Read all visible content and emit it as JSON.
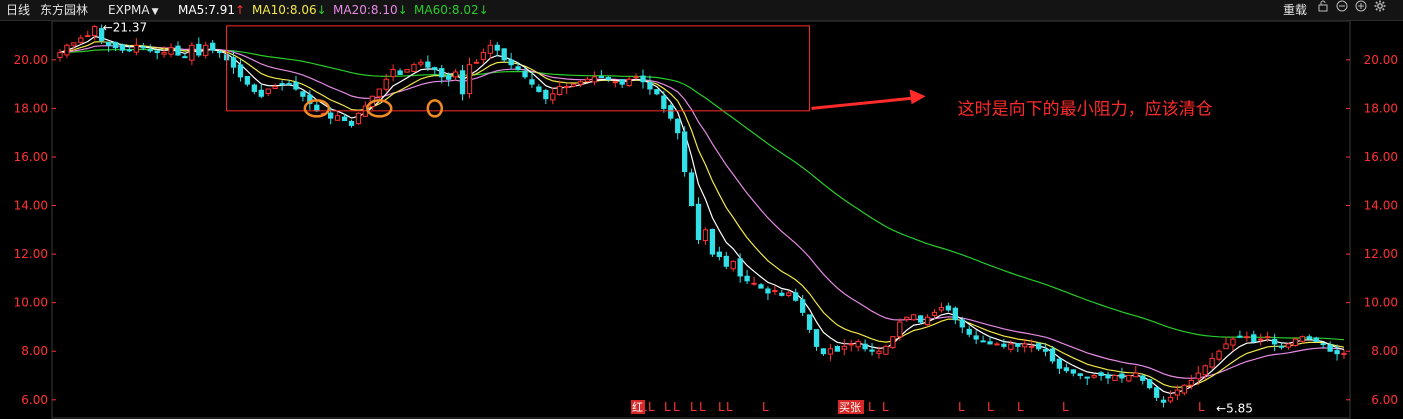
{
  "toolbar": {
    "period": "日线",
    "stock_name": "东方园林",
    "indicator": "EXPMA",
    "dropdown_icon": "caret-down-icon",
    "ma5_label": "MA5:7.91",
    "ma5_dir": "↑",
    "ma10_label": "MA10:8.06",
    "ma10_dir": "↓",
    "ma20_label": "MA20:8.10",
    "ma20_dir": "↓",
    "ma60_label": "MA60:8.02",
    "ma60_dir": "↓",
    "reload": "重载",
    "right_icons": [
      "lock-icon",
      "minus-circle-icon",
      "plus-circle-icon",
      "gear-icon"
    ]
  },
  "colors": {
    "background": "#000000",
    "up_candle": "#ff3333",
    "down_candle": "#33e0e8",
    "ma5": "#ffffff",
    "ma10": "#f2e84a",
    "ma20": "#e58ae5",
    "ma60": "#29cc29",
    "annotation": "#ff2a2a",
    "circle": "#f08a24"
  },
  "chart_data": {
    "type": "candlestick",
    "y_ticks": [
      "20.00",
      "18.00",
      "16.00",
      "14.00",
      "12.00",
      "10.00",
      "8.00",
      "6.00"
    ],
    "y_tick_values": [
      20,
      18,
      16,
      14,
      12,
      10,
      8,
      6
    ],
    "ylim": [
      5.25,
      21.6
    ],
    "axis_side": "both",
    "high_marker": "←21.37",
    "high_value": 21.37,
    "low_marker": "←5.85",
    "low_value": 5.85,
    "annotation_text": "这时是向下的最小阻力，应该清仓",
    "annotation_box_price_range": [
      17.9,
      21.4
    ],
    "support_level": 18.0,
    "signal_marks": [
      "L",
      "L",
      "L",
      "L",
      "L",
      "L",
      "L",
      "L",
      "L",
      "L",
      "L",
      "L",
      "L",
      "L",
      "L",
      "L",
      "L"
    ],
    "signal_badges": [
      "红",
      "买张"
    ],
    "close_series": [
      20.3,
      20.6,
      20.7,
      20.9,
      21.0,
      21.37,
      20.8,
      20.6,
      20.5,
      20.4,
      20.4,
      20.6,
      20.5,
      20.4,
      20.3,
      20.3,
      20.5,
      20.2,
      20.1,
      20.6,
      20.2,
      20.6,
      20.4,
      20.3,
      20.0,
      19.7,
      19.3,
      19.0,
      18.7,
      18.5,
      18.8,
      18.9,
      19.0,
      19.0,
      18.8,
      18.5,
      18.2,
      17.9,
      17.8,
      17.6,
      17.7,
      17.5,
      17.3,
      17.8,
      18.1,
      18.5,
      18.8,
      19.2,
      19.6,
      19.4,
      19.6,
      19.8,
      19.9,
      19.7,
      19.6,
      19.3,
      19.2,
      19.5,
      18.6,
      19.8,
      19.9,
      20.3,
      20.6,
      20.4,
      20.0,
      19.8,
      19.6,
      19.3,
      19.0,
      18.7,
      18.4,
      18.6,
      18.9,
      18.9,
      19.0,
      19.1,
      19.2,
      19.3,
      19.3,
      19.2,
      19.1,
      19.0,
      19.2,
      19.3,
      19.1,
      18.8,
      18.6,
      18.0,
      17.6,
      17.0,
      15.4,
      14.0,
      12.6,
      13.0,
      12.0,
      11.9,
      11.5,
      11.7,
      11.1,
      10.9,
      10.8,
      10.6,
      10.4,
      10.5,
      10.3,
      10.4,
      10.1,
      9.6,
      8.9,
      8.2,
      7.9,
      8.1,
      8.0,
      8.2,
      8.3,
      8.4,
      8.1,
      8.0,
      8.0,
      8.2,
      8.6,
      9.2,
      9.4,
      9.5,
      9.2,
      9.4,
      9.6,
      9.8,
      9.7,
      9.3,
      9.0,
      8.7,
      8.5,
      8.4,
      8.3,
      8.3,
      8.2,
      8.3,
      8.2,
      8.3,
      8.2,
      8.1,
      8.0,
      7.6,
      7.3,
      7.2,
      7.1,
      7.0,
      6.9,
      7.0,
      7.0,
      6.9,
      7.0,
      6.9,
      7.0,
      7.1,
      6.8,
      6.5,
      6.1,
      5.9,
      6.1,
      6.4,
      6.6,
      6.8,
      7.1,
      7.4,
      7.7,
      8.0,
      8.3,
      8.5,
      8.6,
      8.6,
      8.4,
      8.5,
      8.6,
      8.3,
      8.2,
      8.3,
      8.5,
      8.6,
      8.5,
      8.4,
      8.3,
      8.0,
      7.9,
      7.91
    ]
  }
}
